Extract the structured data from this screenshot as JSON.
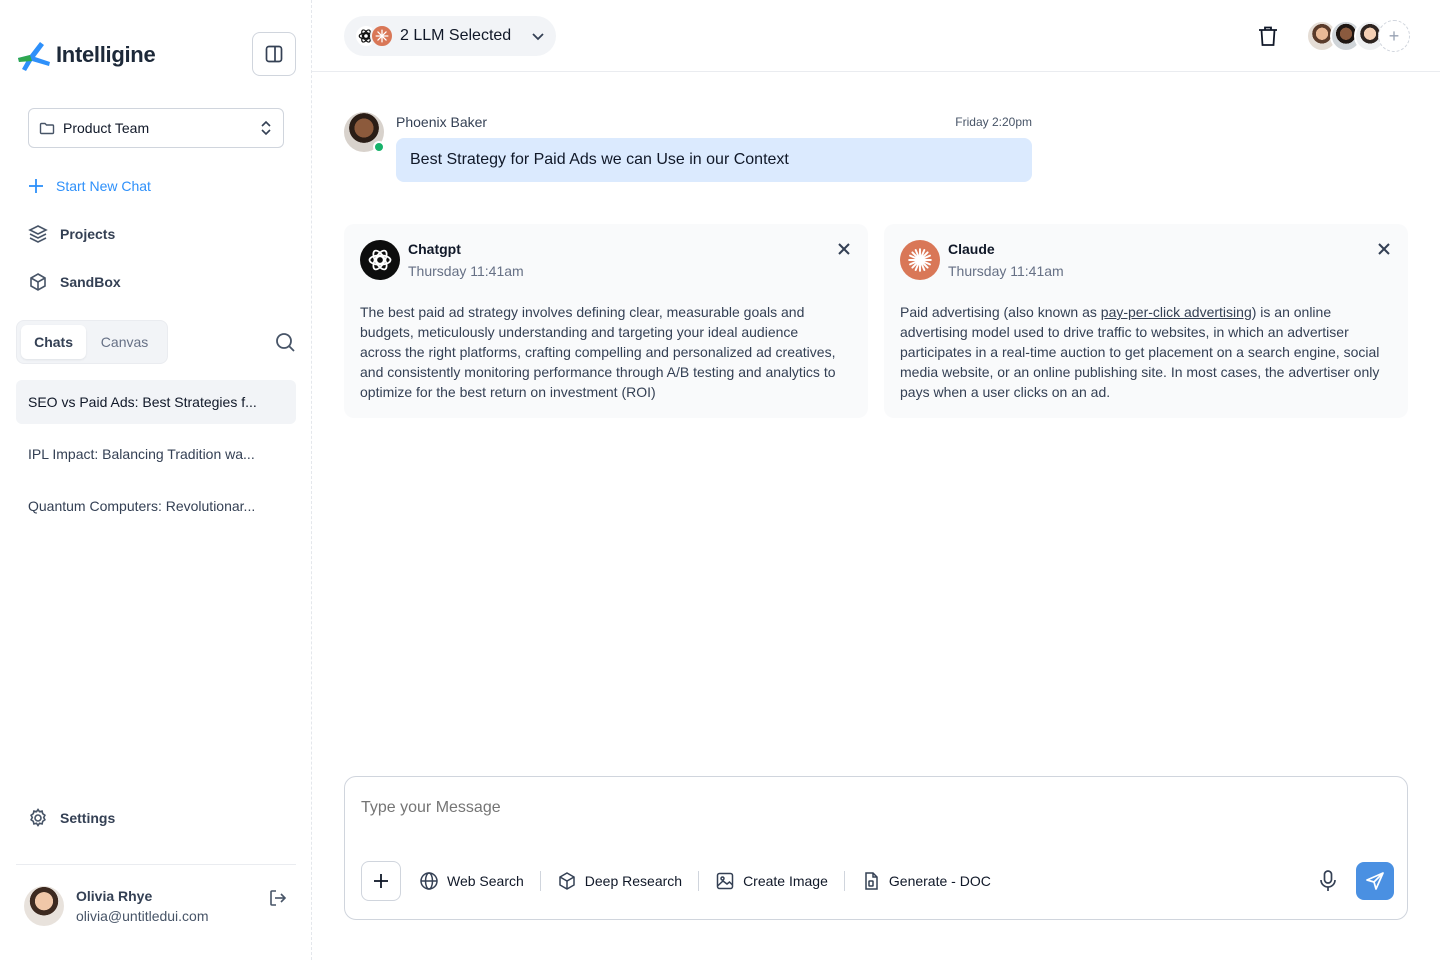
{
  "app": {
    "name": "Intelligine",
    "brand_colors": {
      "primary": "#2e90fa",
      "logo_green": "#2fa84f",
      "send": "#4a90e2"
    }
  },
  "sidebar": {
    "team_select": {
      "value": "Product Team",
      "icon": "folder-icon"
    },
    "nav": {
      "new_chat": "Start New Chat",
      "projects": "Projects",
      "sandbox": "SandBox",
      "settings": "Settings"
    },
    "tabs": [
      {
        "label": "Chats",
        "active": true
      },
      {
        "label": "Canvas",
        "active": false
      }
    ],
    "chats": [
      {
        "title": "SEO vs Paid Ads: Best Strategies f...",
        "active": true
      },
      {
        "title": "IPL Impact: Balancing Tradition wa...",
        "active": false
      },
      {
        "title": "Quantum Computers: Revolutionar...",
        "active": false
      }
    ],
    "user": {
      "name": "Olivia Rhye",
      "email": "olivia@untitledui.com"
    }
  },
  "topbar": {
    "llm_selected_label": "2 LLM Selected",
    "models": [
      "chatgpt-icon",
      "claude-icon"
    ]
  },
  "message": {
    "author": "Phoenix Baker",
    "time": "Friday 2:20pm",
    "text": "Best Strategy for Paid Ads we can Use in our Context",
    "online": true
  },
  "responses": [
    {
      "model": "Chatgpt",
      "time": "Thursday 11:41am",
      "text": "The best paid ad strategy involves defining clear, measurable goals and budgets, meticulously understanding and targeting your ideal audience across the right platforms, crafting compelling and personalized ad creatives, and consistently monitoring performance through A/B testing and analytics to optimize for the best return on investment (ROI)"
    },
    {
      "model": "Claude",
      "time": "Thursday 11:41am",
      "text_before": "Paid advertising (also known as ",
      "link": "pay-per-click advertising",
      "text_after": ") is an online advertising model used to drive traffic to websites, in which an advertiser participates in a real-time auction to get placement on a search engine, social media website, or an online publishing site. In most cases, the advertiser only pays when a user clicks on an ad."
    }
  ],
  "composer": {
    "placeholder": "Type your Message",
    "tools": {
      "web_search": "Web Search",
      "deep_research": "Deep Research",
      "create_image": "Create Image",
      "generate_doc": "Generate - DOC"
    }
  }
}
